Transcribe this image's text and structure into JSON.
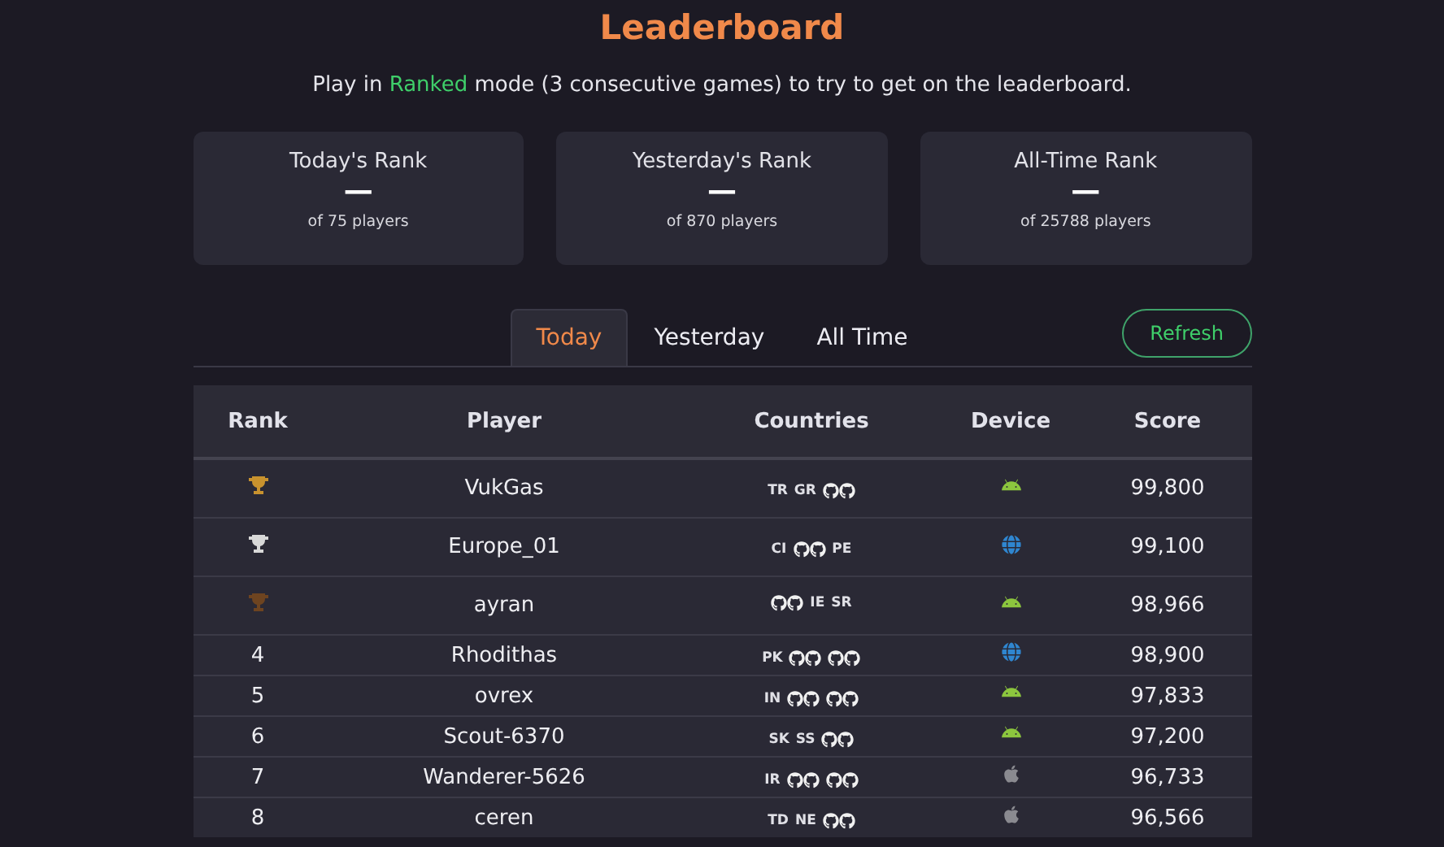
{
  "title": "Leaderboard",
  "intro": "Play in **Ranked** mode (3 consecutive games) to try to get on the leaderboard.",
  "rank_cards": [
    {
      "label": "Today's Rank",
      "value": "—",
      "sub": "of 75 players"
    },
    {
      "label": "Yesterday's Rank",
      "value": "—",
      "sub": "of 870 players"
    },
    {
      "label": "All-Time Rank",
      "value": "—",
      "sub": "of 25788 players"
    }
  ],
  "tabs": [
    {
      "label": "Today",
      "selected": true
    },
    {
      "label": "Yesterday",
      "selected": false
    },
    {
      "label": "All Time",
      "selected": false
    }
  ],
  "refresh_button": "Refresh",
  "table": {
    "columns": [
      "Rank",
      "Player",
      "Countries",
      "Device",
      "Score"
    ],
    "rows": [
      {
        "rank": {
          "kind": "trophy",
          "color": "#c8922e"
        },
        "player": "VukGas",
        "countries": [
          {
            "kind": "code",
            "text": "TR"
          },
          {
            "kind": "code",
            "text": "GR"
          },
          {
            "kind": "icon"
          }
        ],
        "device": {
          "kind": "android"
        },
        "score": "99,800"
      },
      {
        "rank": {
          "kind": "trophy",
          "color": "#d8d8d8"
        },
        "player": "Europe_01",
        "countries": [
          {
            "kind": "code",
            "text": "CI"
          },
          {
            "kind": "icon"
          },
          {
            "kind": "code",
            "text": "PE"
          }
        ],
        "device": {
          "kind": "web"
        },
        "score": "99,100"
      },
      {
        "rank": {
          "kind": "trophy",
          "color": "#6e4420"
        },
        "player": "ayran",
        "countries": [
          {
            "kind": "icon"
          },
          {
            "kind": "code",
            "text": "IE"
          },
          {
            "kind": "code",
            "text": "SR"
          }
        ],
        "device": {
          "kind": "android"
        },
        "score": "98,966"
      },
      {
        "rank": {
          "kind": "number",
          "text": "4"
        },
        "player": "Rhodithas",
        "countries": [
          {
            "kind": "code",
            "text": "PK"
          },
          {
            "kind": "icon"
          },
          {
            "kind": "icon"
          }
        ],
        "device": {
          "kind": "web"
        },
        "score": "98,900"
      },
      {
        "rank": {
          "kind": "number",
          "text": "5"
        },
        "player": "ovrex",
        "countries": [
          {
            "kind": "code",
            "text": "IN"
          },
          {
            "kind": "icon"
          },
          {
            "kind": "icon"
          }
        ],
        "device": {
          "kind": "android"
        },
        "score": "97,833"
      },
      {
        "rank": {
          "kind": "number",
          "text": "6"
        },
        "player": "Scout-6370",
        "countries": [
          {
            "kind": "code",
            "text": "SK"
          },
          {
            "kind": "code",
            "text": "SS"
          },
          {
            "kind": "icon"
          }
        ],
        "device": {
          "kind": "android"
        },
        "score": "97,200"
      },
      {
        "rank": {
          "kind": "number",
          "text": "7"
        },
        "player": "Wanderer-5626",
        "countries": [
          {
            "kind": "code",
            "text": "IR"
          },
          {
            "kind": "icon"
          },
          {
            "kind": "icon"
          }
        ],
        "device": {
          "kind": "apple"
        },
        "score": "96,733"
      },
      {
        "rank": {
          "kind": "number",
          "text": "8"
        },
        "player": "ceren",
        "countries": [
          {
            "kind": "code",
            "text": "TD"
          },
          {
            "kind": "code",
            "text": "NE"
          },
          {
            "kind": "icon"
          }
        ],
        "device": {
          "kind": "apple"
        },
        "score": "96,566"
      }
    ]
  }
}
